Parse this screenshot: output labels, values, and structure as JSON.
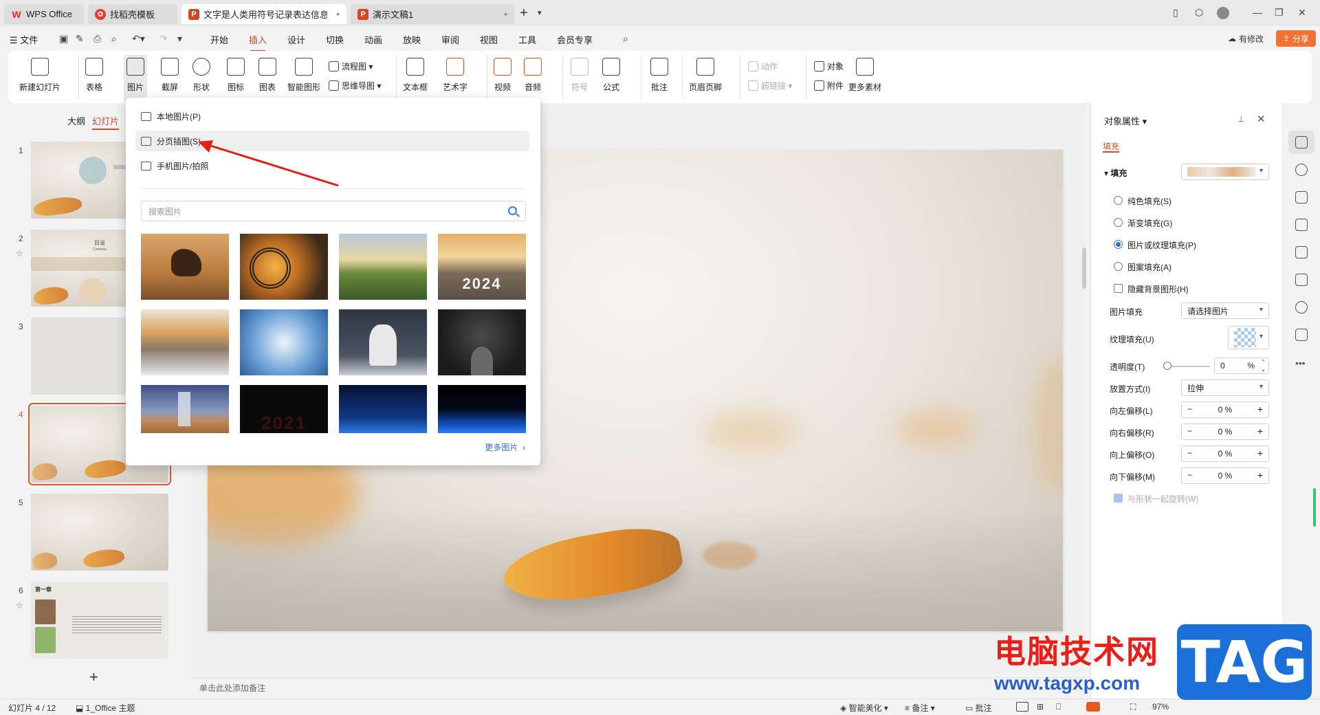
{
  "tabs": [
    {
      "label": "WPS Office"
    },
    {
      "label": "找稻壳模板"
    },
    {
      "label": "文字是人类用符号记录表达信息以"
    },
    {
      "label": "演示文稿1"
    }
  ],
  "menu": {
    "file": "文件",
    "items": [
      "开始",
      "插入",
      "设计",
      "切换",
      "动画",
      "放映",
      "审阅",
      "视图",
      "工具",
      "会员专享"
    ],
    "active": "插入",
    "status_label": "有修改",
    "share": "分享"
  },
  "ribbon": {
    "new_slide": "新建幻灯片",
    "table": "表格",
    "picture": "图片",
    "screenshot": "截屏",
    "shape": "形状",
    "icon": "图标",
    "chart": "图表",
    "smartart": "智能图形",
    "flowchart": "流程图",
    "mindmap": "思维导图",
    "textbox": "文本框",
    "wordart": "艺术字",
    "video": "视频",
    "audio": "音频",
    "symbol": "符号",
    "formula": "公式",
    "comment": "批注",
    "header_footer": "页眉页脚",
    "action": "动作",
    "hyperlink": "超链接",
    "object": "对象",
    "attachment": "附件",
    "more_material": "更多素材"
  },
  "left_panel": {
    "tab_outline": "大纲",
    "tab_slides": "幻灯片",
    "slides": [
      "1",
      "2",
      "3",
      "4",
      "5",
      "6"
    ],
    "slide2_title": "目录",
    "slide2_sub": "Contents",
    "slide6_title": "第一章"
  },
  "picture_menu": {
    "local": "本地图片(P)",
    "page_insert": "分页插图(S)",
    "phone": "手机图片/拍照",
    "search_placeholder": "搜索图片",
    "year_2024": "2024",
    "year_2021": "2021",
    "more": "更多图片"
  },
  "properties": {
    "title": "对象属性",
    "tab_fill": "填充",
    "section_fill": "填充",
    "options": [
      "纯色填充(S)",
      "渐变填充(G)",
      "图片或纹理填充(P)",
      "图案填充(A)"
    ],
    "selected_option": "图片或纹理填充(P)",
    "hide_bg": "隐藏背景图形(H)",
    "picture_fill_label": "图片填充",
    "picture_fill_value": "请选择图片",
    "texture_fill_label": "纹理填充(U)",
    "transparency_label": "透明度(T)",
    "transparency_value": "0",
    "percent": "%",
    "placement_label": "放置方式(I)",
    "placement_value": "拉伸",
    "offset_left_label": "向左偏移(L)",
    "offset_right_label": "向右偏移(R)",
    "offset_top_label": "向上偏移(O)",
    "offset_bottom_label": "向下偏移(M)",
    "offset_value": "0 %",
    "rotate_with_shape": "与形状一起旋转(W)"
  },
  "notes_placeholder": "单击此处添加备注",
  "status": {
    "slide_pos": "幻灯片 4 / 12",
    "theme": "1_Office 主题",
    "beautify": "智能美化",
    "notes": "备注",
    "comments": "批注",
    "zoom": "97%"
  },
  "watermark": {
    "site_name": "电脑技术网",
    "url": "www.tagxp.com",
    "tag": "TAG"
  }
}
